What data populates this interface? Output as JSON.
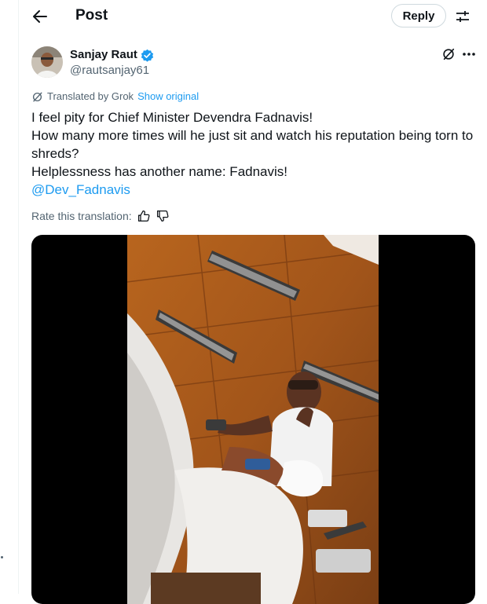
{
  "header": {
    "title": "Post",
    "reply_label": "Reply"
  },
  "author": {
    "name": "Sanjay Raut",
    "handle": "@rautsanjay61",
    "verified": true
  },
  "translation": {
    "label": "Translated by Grok",
    "show_original": "Show original"
  },
  "tweet": {
    "lines": [
      "I feel pity for Chief Minister Devendra Fadnavis!",
      "How many more times will he just sit and watch his reputation being torn to shreds?",
      "Helplessness has another name: Fadnavis!"
    ],
    "mention": "@Dev_Fadnavis"
  },
  "rating": {
    "label": "Rate this translation:"
  },
  "colors": {
    "accent": "#1d9bf0",
    "secondary_text": "#536471",
    "border": "#cfd9de"
  },
  "icons": {
    "back": "arrow-left-icon",
    "filter": "sliders-icon",
    "grok": "grok-icon",
    "more": "more-dots-icon",
    "verified": "verified-badge-icon",
    "thumbs_up": "thumbs-up-icon",
    "thumbs_down": "thumbs-down-icon"
  }
}
